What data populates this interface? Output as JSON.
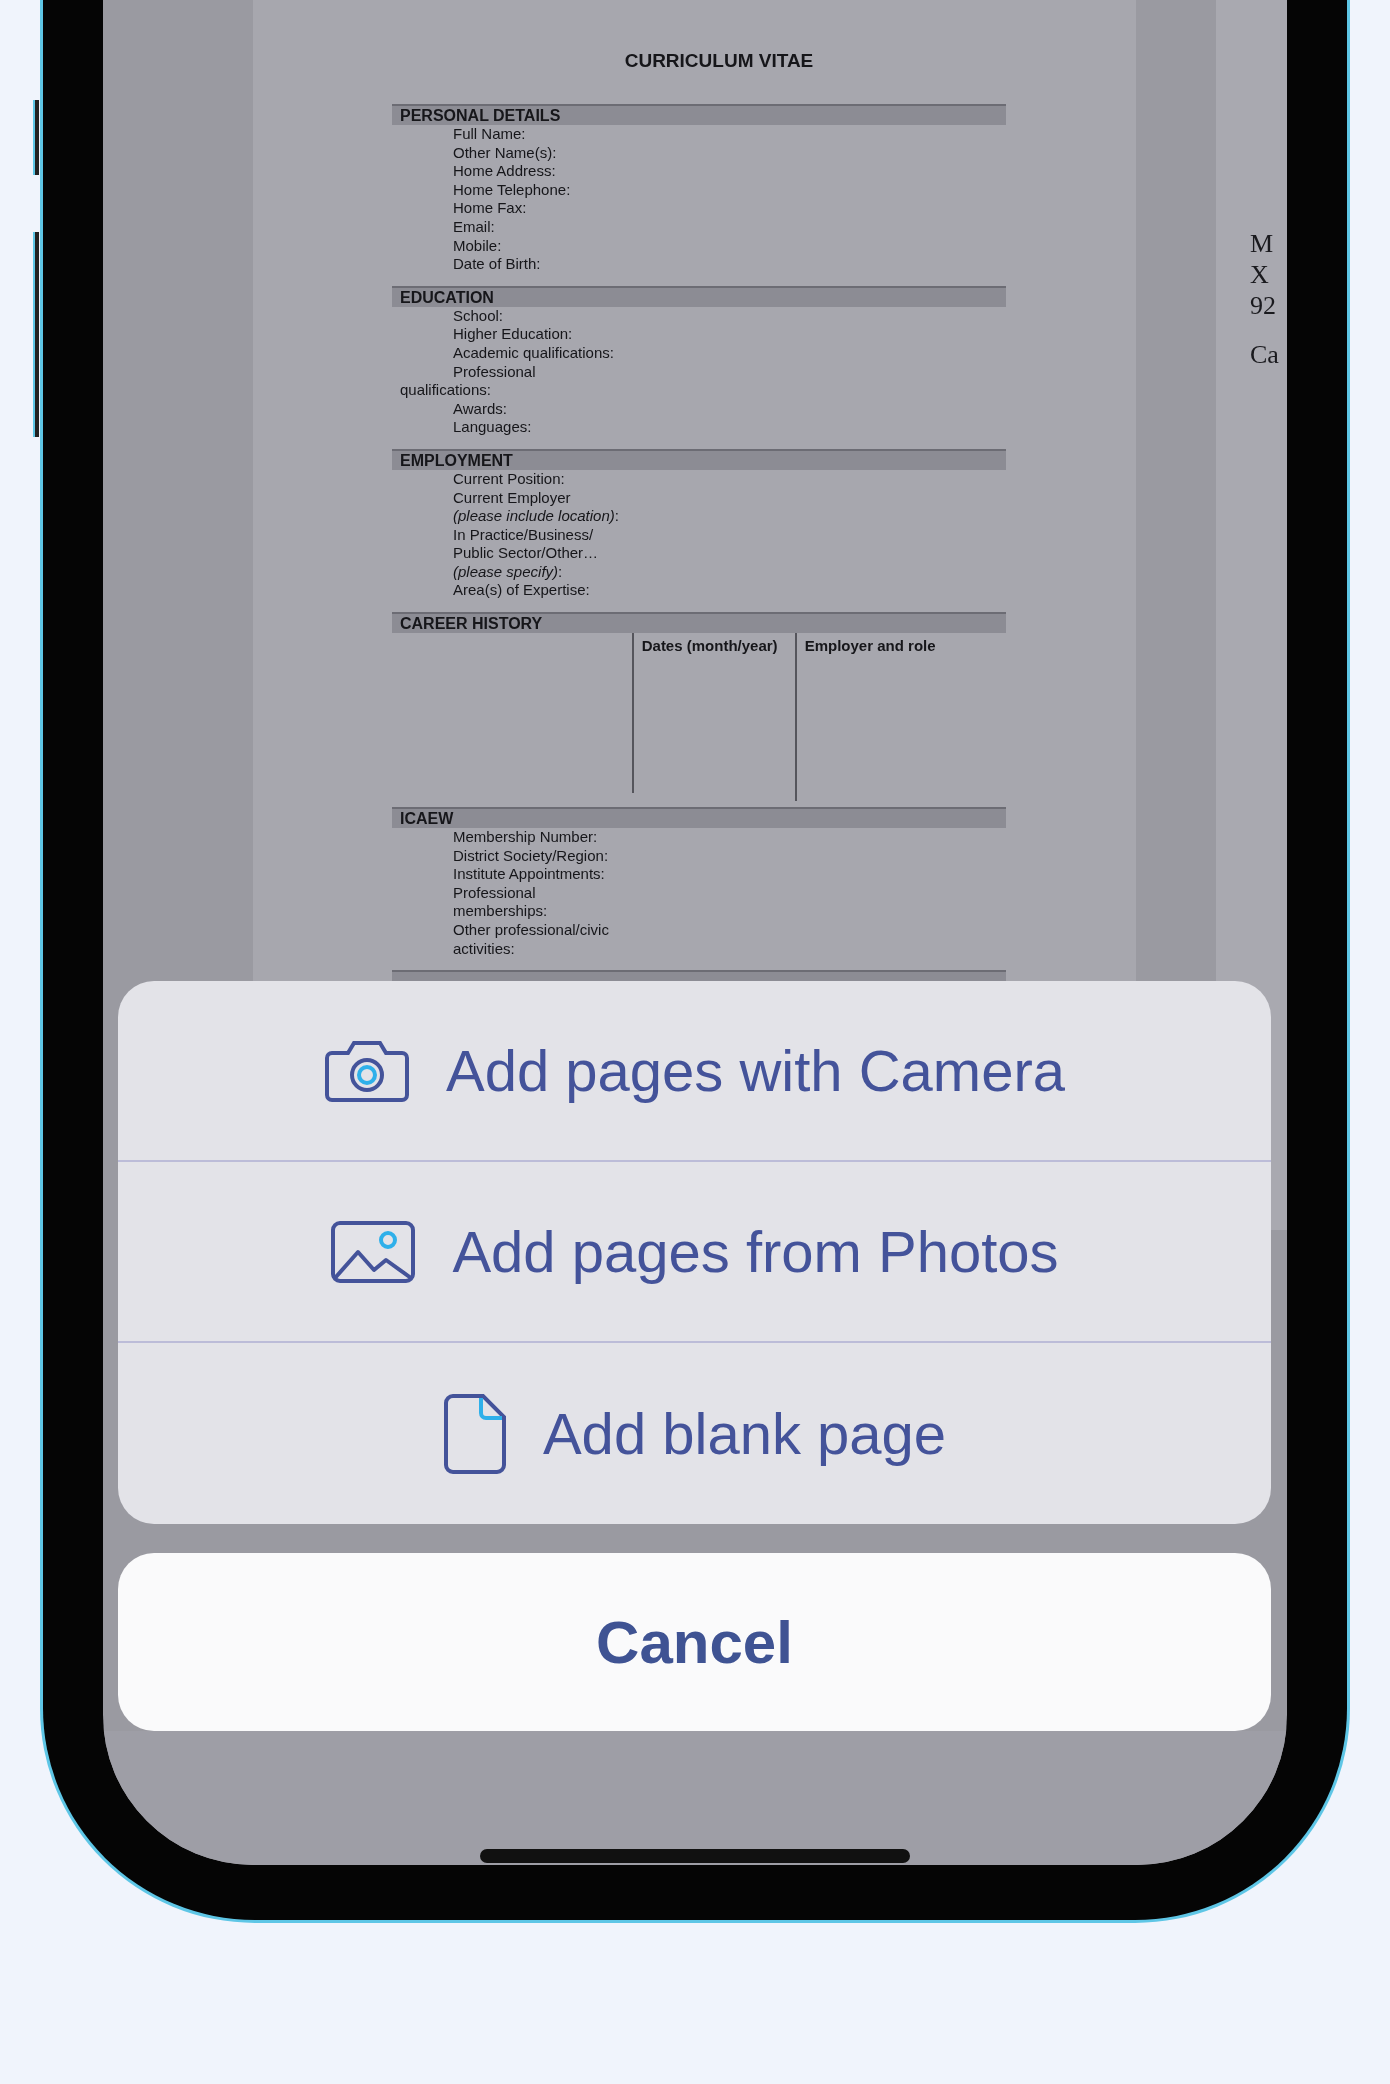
{
  "document": {
    "title": "CURRICULUM VITAE",
    "sections": [
      {
        "heading": "PERSONAL DETAILS",
        "kind": "fields",
        "fields": [
          {
            "text": "Full Name:",
            "flush": false
          },
          {
            "text": "Other Name(s):",
            "flush": false
          },
          {
            "text": "Home Address:",
            "flush": false
          },
          {
            "text": "Home Telephone:",
            "flush": false
          },
          {
            "text": "Home Fax:",
            "flush": false
          },
          {
            "text": "Email:",
            "flush": false
          },
          {
            "text": "Mobile:",
            "flush": false
          },
          {
            "text": "Date of Birth:",
            "flush": false
          }
        ]
      },
      {
        "heading": "EDUCATION",
        "kind": "fields",
        "fields": [
          {
            "text": "School:",
            "flush": false
          },
          {
            "text": "Higher Education:",
            "flush": false
          },
          {
            "text": "Academic qualifications:",
            "flush": false
          },
          {
            "text": "Professional",
            "flush": false
          },
          {
            "text": "qualifications:",
            "flush": true
          },
          {
            "text": "Awards:",
            "flush": false
          },
          {
            "text": "Languages:",
            "flush": false
          }
        ]
      },
      {
        "heading": "EMPLOYMENT",
        "kind": "fields",
        "fields": [
          {
            "text": "Current Position:",
            "flush": false
          },
          {
            "text": "Current Employer",
            "flush": false
          },
          {
            "text": "*(please include location)*:",
            "flush": false
          },
          {
            "text": "In Practice/Business/",
            "flush": false
          },
          {
            "text": "Public Sector/Other…",
            "flush": false
          },
          {
            "text": "*(please specify)*:",
            "flush": false
          },
          {
            "text": "Area(s) of Expertise:",
            "flush": false
          }
        ]
      },
      {
        "heading": "CAREER HISTORY",
        "kind": "table",
        "columns": [
          "Dates (month/year)",
          "Employer and role"
        ]
      },
      {
        "heading": "ICAEW",
        "kind": "fields",
        "fields": [
          {
            "text": "Membership Number:",
            "flush": false
          },
          {
            "text": "District Society/Region:",
            "flush": false
          },
          {
            "text": "Institute Appointments:",
            "flush": false
          },
          {
            "text": "Professional",
            "flush": false
          },
          {
            "text": "memberships:",
            "flush": false
          },
          {
            "text": "Other professional/civic",
            "flush": false
          },
          {
            "text": "activities:",
            "flush": false
          }
        ]
      }
    ],
    "next_page_lines": [
      "M",
      "X",
      "92",
      "Ca"
    ]
  },
  "action_sheet": {
    "options": [
      {
        "label": "Add pages with Camera",
        "kind": "camera"
      },
      {
        "label": "Add pages from Photos",
        "kind": "photos"
      },
      {
        "label": "Add blank page",
        "kind": "blank"
      }
    ],
    "cancel": "Cancel"
  }
}
